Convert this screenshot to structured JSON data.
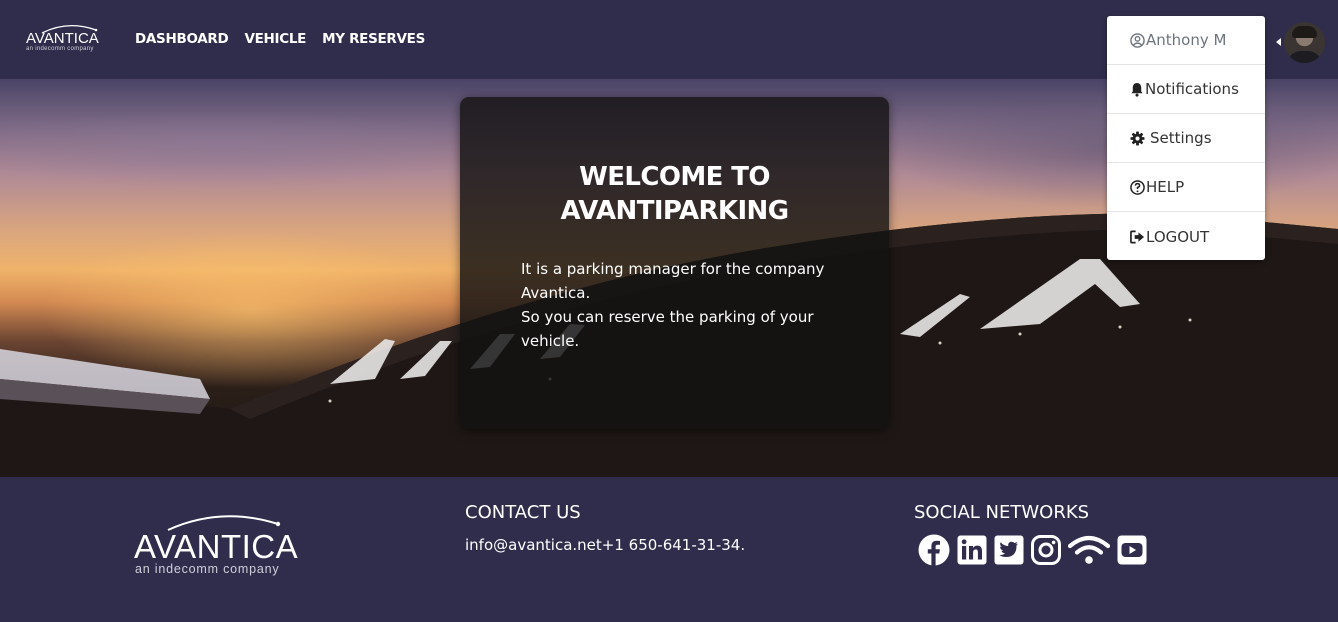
{
  "brand": {
    "name": "AVANTICA",
    "tagline": "an indecomm company"
  },
  "nav": {
    "items": [
      {
        "label": "DASHBOARD"
      },
      {
        "label": "VEHICLE"
      },
      {
        "label": "MY RESERVES"
      }
    ]
  },
  "user_menu": {
    "items": [
      {
        "label": "Anthony M",
        "icon": "user-circle-icon"
      },
      {
        "label": "Notifications",
        "icon": "bell-icon"
      },
      {
        "label": "Settings",
        "icon": "gear-icon"
      },
      {
        "label": "HELP",
        "icon": "question-circle-icon"
      },
      {
        "label": "LOGOUT",
        "icon": "sign-out-icon"
      }
    ]
  },
  "welcome": {
    "title_line1": "WELCOME TO",
    "title_line2": "AVANTIPARKING",
    "para1": "It is a parking manager for the company Avantica.",
    "para2": "So you can reserve the parking of your vehicle."
  },
  "footer": {
    "contact_title": "CONTACT US",
    "contact_text": "info@avantica.net+1 650-641-31-34.",
    "social_title": "SOCIAL NETWORKS",
    "social_icons": [
      "facebook-icon",
      "linkedin-icon",
      "twitter-icon",
      "instagram-icon",
      "wifi-icon",
      "youtube-icon"
    ]
  },
  "colors": {
    "navbar_bg": "#2f2d4b",
    "footer_bg": "#2f2d4b",
    "card_bg": "#141212",
    "text_light": "#ffffff"
  }
}
